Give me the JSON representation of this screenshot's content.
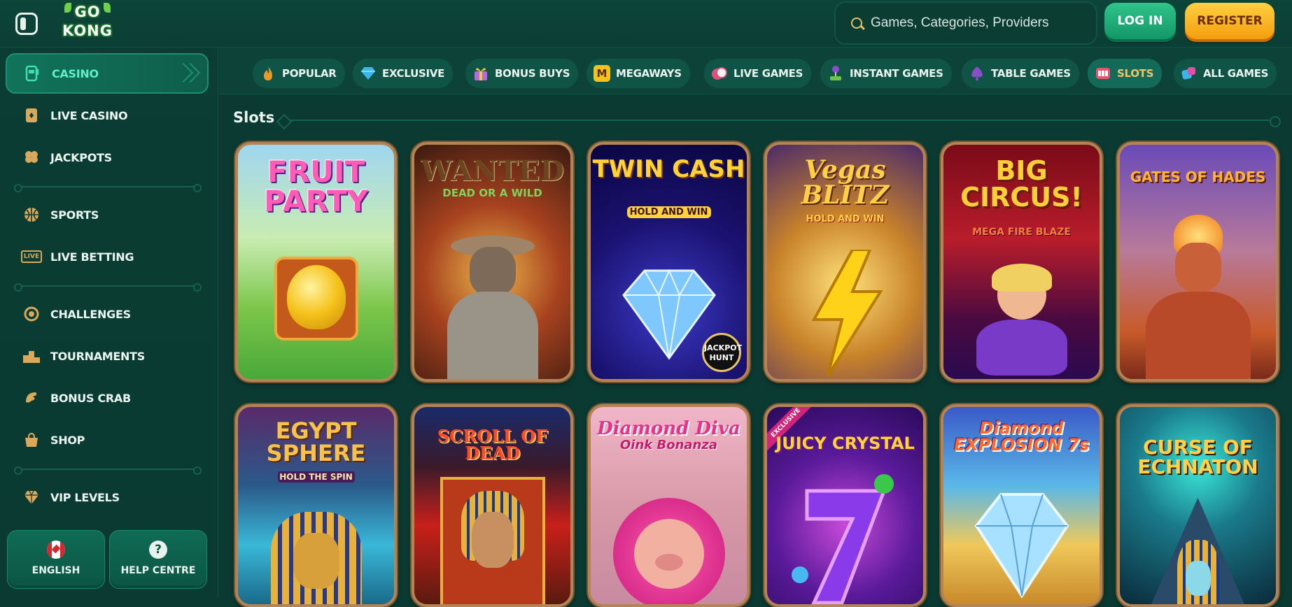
{
  "header": {
    "logo_line1": "GO",
    "logo_line2": "KONG",
    "search_placeholder": "Games, Categories, Providers",
    "login_label": "LOG IN",
    "register_label": "REGISTER"
  },
  "sidebar": {
    "items": [
      {
        "label": "CASINO",
        "icon": "slot-machine-icon",
        "active": true
      },
      {
        "label": "LIVE CASINO",
        "icon": "playing-card-icon"
      },
      {
        "label": "JACKPOTS",
        "icon": "clover-icon"
      },
      {
        "label": "SPORTS",
        "icon": "basketball-icon"
      },
      {
        "label": "LIVE BETTING",
        "icon": "live-icon",
        "icon_text": "LIVE"
      },
      {
        "label": "CHALLENGES",
        "icon": "medal-icon"
      },
      {
        "label": "TOURNAMENTS",
        "icon": "podium-icon"
      },
      {
        "label": "BONUS CRAB",
        "icon": "crab-claw-icon"
      },
      {
        "label": "SHOP",
        "icon": "shopping-bag-icon"
      },
      {
        "label": "VIP LEVELS",
        "icon": "diamond-icon"
      }
    ],
    "language_label": "ENGLISH",
    "help_label": "HELP CENTRE",
    "help_icon_text": "?"
  },
  "tabs": [
    {
      "label": "POPULAR",
      "icon": "flame-icon"
    },
    {
      "label": "EXCLUSIVE",
      "icon": "gem-icon"
    },
    {
      "label": "BONUS BUYS",
      "icon": "gift-icon"
    },
    {
      "label": "MEGAWAYS",
      "icon": "megaways-icon",
      "icon_text": "M"
    },
    {
      "label": "LIVE GAMES",
      "icon": "chips-icon"
    },
    {
      "label": "INSTANT GAMES",
      "icon": "joystick-icon"
    },
    {
      "label": "TABLE GAMES",
      "icon": "spade-icon"
    },
    {
      "label": "SLOTS",
      "icon": "slot-icon",
      "active": true
    },
    {
      "label": "ALL GAMES",
      "icon": "dice-icon"
    }
  ],
  "section": {
    "title": "Slots"
  },
  "games": [
    {
      "title": "FRUIT PARTY"
    },
    {
      "title": "WANTED",
      "subtitle": "DEAD OR A WILD"
    },
    {
      "title": "TWIN CASH",
      "subtitle": "HOLD AND WIN",
      "badge": "JACKPOT HUNT"
    },
    {
      "title": "Vegas BLITZ",
      "subtitle": "HOLD AND WIN"
    },
    {
      "title": "BIG CIRCUS!",
      "subtitle": "MEGA FIRE BLAZE"
    },
    {
      "title": "GATES OF HADES"
    },
    {
      "title": "EGYPT SPHERE",
      "subtitle": "HOLD THE SPIN"
    },
    {
      "title": "SCROLL OF DEAD"
    },
    {
      "title": "Diamond Diva",
      "subtitle": "Oink Bonanza"
    },
    {
      "title": "JUICY CRYSTAL",
      "badge": "EXCLUSIVE"
    },
    {
      "title": "Diamond EXPLOSION 7s"
    },
    {
      "title": "CURSE OF ECHNATON"
    }
  ],
  "colors": {
    "background": "#0a3a31",
    "accent_green": "#5ff0c2",
    "login": "#1aa874",
    "register": "#f7b51e",
    "card_border": "#b38556"
  }
}
